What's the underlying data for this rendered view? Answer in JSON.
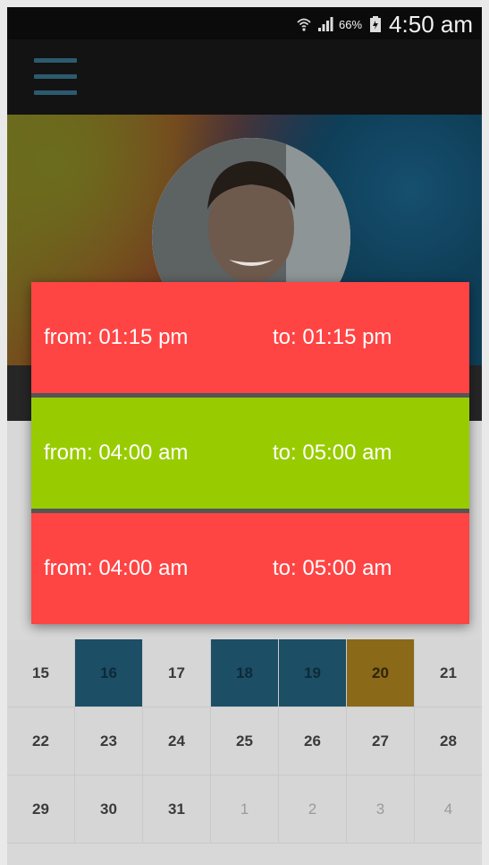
{
  "status_bar": {
    "wifi_icon": "wifi-icon",
    "signal_icon": "signal-icon",
    "battery_percent": "66%",
    "battery_icon": "battery-icon",
    "time": "4:50 am"
  },
  "toolbar": {
    "menu_icon": "menu-icon"
  },
  "profile": {
    "avatar_icon": "avatar"
  },
  "colors": {
    "slot_red": "#ff4444",
    "slot_green": "#99cc00",
    "busy_day": "#1c4e66",
    "today": "#8a6a18"
  },
  "time_slots": [
    {
      "from": "from: 01:15 pm",
      "to": "to: 01:15 pm",
      "color": "#ff4444"
    },
    {
      "from": "from: 04:00 am",
      "to": "to: 05:00 am",
      "color": "#99cc00"
    },
    {
      "from": "from: 04:00 am",
      "to": "to: 05:00 am",
      "color": "#ff4444"
    }
  ],
  "calendar": {
    "weeks": [
      [
        "15",
        "16",
        "17",
        "18",
        "19",
        "20",
        "21"
      ],
      [
        "22",
        "23",
        "24",
        "25",
        "26",
        "27",
        "28"
      ],
      [
        "29",
        "30",
        "31",
        "1",
        "2",
        "3",
        "4"
      ]
    ],
    "busy_days": [
      "16",
      "18",
      "19"
    ],
    "highlight_day": "20"
  }
}
